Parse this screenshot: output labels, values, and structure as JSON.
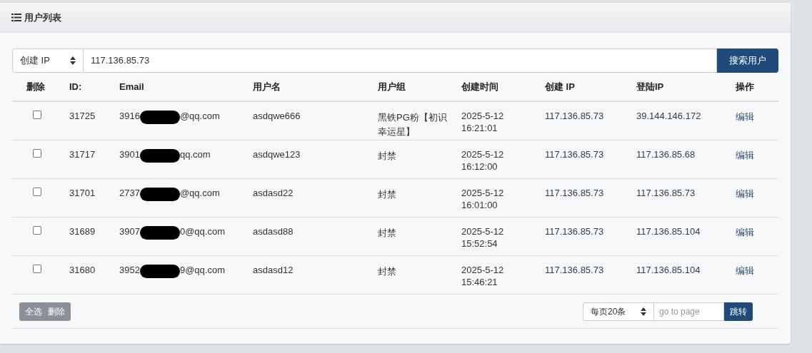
{
  "panel": {
    "title": "用户列表"
  },
  "search": {
    "field": "创建 IP",
    "value": "117.136.85.73",
    "button": "搜索用户"
  },
  "table": {
    "columns": [
      "删除",
      "ID:",
      "Email",
      "用户名",
      "用户组",
      "创建时间",
      "创建 IP",
      "登陆IP",
      "操作"
    ],
    "rows": [
      {
        "checked": false,
        "id": "31725",
        "email_start": "3916",
        "email_end": "@qq.com",
        "username": "asdqwe666",
        "group": "黑铁PG粉【初识幸运星】",
        "created_date": "2025-5-12",
        "created_time": "16:21:01",
        "create_ip": "117.136.85.73",
        "login_ip": "39.144.146.172",
        "action": "编辑"
      },
      {
        "checked": false,
        "id": "31717",
        "email_start": "3901",
        "email_end": "qq.com",
        "username": "asdqwe123",
        "group": "封禁",
        "created_date": "2025-5-12",
        "created_time": "16:12:00",
        "create_ip": "117.136.85.73",
        "login_ip": "117.136.85.68",
        "action": "编辑"
      },
      {
        "checked": false,
        "id": "31701",
        "email_start": "2737",
        "email_end": "@qq.com",
        "username": "asdasd22",
        "group": "封禁",
        "created_date": "2025-5-12",
        "created_time": "16:01:00",
        "create_ip": "117.136.85.73",
        "login_ip": "117.136.85.73",
        "action": "编辑"
      },
      {
        "checked": false,
        "id": "31689",
        "email_start": "3907",
        "email_end": "0@qq.com",
        "username": "asdasd88",
        "group": "封禁",
        "created_date": "2025-5-12",
        "created_time": "15:52:54",
        "create_ip": "117.136.85.73",
        "login_ip": "117.136.85.104",
        "action": "编辑"
      },
      {
        "checked": false,
        "id": "31680",
        "email_start": "3952",
        "email_end": "9@qq.com",
        "username": "asdasd12",
        "group": "封禁",
        "created_date": "2025-5-12",
        "created_time": "15:46:21",
        "create_ip": "117.136.85.73",
        "login_ip": "117.136.85.104",
        "action": "编辑"
      }
    ]
  },
  "footer": {
    "select_all": "全选",
    "delete": "删除",
    "page_size": "每页20条",
    "page_placeholder": "go to page",
    "jump": "跳转"
  }
}
